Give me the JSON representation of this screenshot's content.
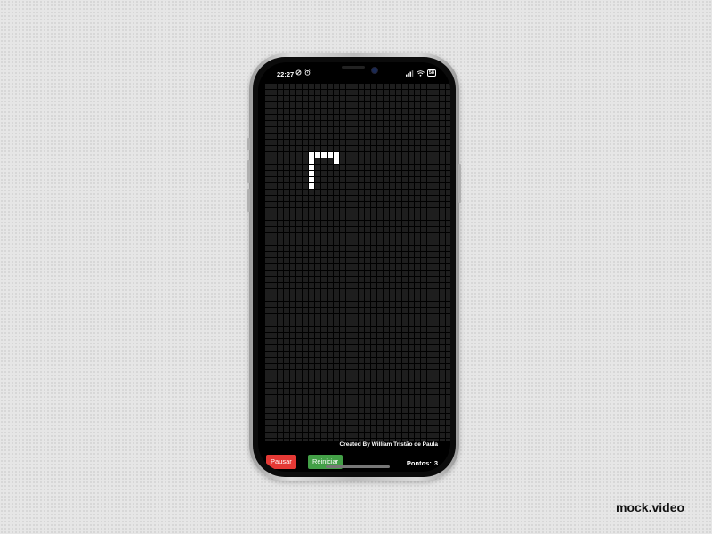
{
  "status_bar": {
    "time": "22:27",
    "battery_level": "58",
    "icons_left": [
      "sync-icon",
      "alarm-icon"
    ],
    "icons_right": [
      "signal-icon",
      "wifi-icon",
      "battery-icon"
    ]
  },
  "game": {
    "grid_columns": 30,
    "grid_rows": 57,
    "snake_color": "#ffffff",
    "board_color": "#1e1e1e"
  },
  "footer": {
    "credit": "Created By William Tristão de Paula",
    "pause_label": "Pausar",
    "restart_label": "Reiniciar",
    "score_label": "Pontos:",
    "score_value": "3"
  },
  "colors": {
    "pause_button": "#e53935",
    "restart_button": "#43a047"
  },
  "watermark": "mock.video"
}
